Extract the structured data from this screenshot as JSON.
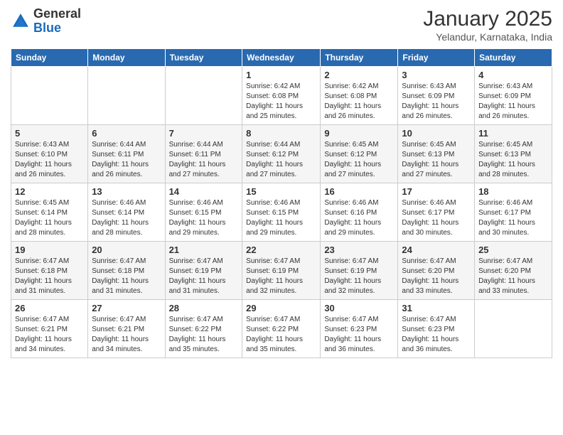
{
  "logo": {
    "general": "General",
    "blue": "Blue"
  },
  "title": "January 2025",
  "location": "Yelandur, Karnataka, India",
  "days_of_week": [
    "Sunday",
    "Monday",
    "Tuesday",
    "Wednesday",
    "Thursday",
    "Friday",
    "Saturday"
  ],
  "weeks": [
    [
      {
        "day": "",
        "info": ""
      },
      {
        "day": "",
        "info": ""
      },
      {
        "day": "",
        "info": ""
      },
      {
        "day": "1",
        "info": "Sunrise: 6:42 AM\nSunset: 6:08 PM\nDaylight: 11 hours\nand 25 minutes."
      },
      {
        "day": "2",
        "info": "Sunrise: 6:42 AM\nSunset: 6:08 PM\nDaylight: 11 hours\nand 26 minutes."
      },
      {
        "day": "3",
        "info": "Sunrise: 6:43 AM\nSunset: 6:09 PM\nDaylight: 11 hours\nand 26 minutes."
      },
      {
        "day": "4",
        "info": "Sunrise: 6:43 AM\nSunset: 6:09 PM\nDaylight: 11 hours\nand 26 minutes."
      }
    ],
    [
      {
        "day": "5",
        "info": "Sunrise: 6:43 AM\nSunset: 6:10 PM\nDaylight: 11 hours\nand 26 minutes."
      },
      {
        "day": "6",
        "info": "Sunrise: 6:44 AM\nSunset: 6:11 PM\nDaylight: 11 hours\nand 26 minutes."
      },
      {
        "day": "7",
        "info": "Sunrise: 6:44 AM\nSunset: 6:11 PM\nDaylight: 11 hours\nand 27 minutes."
      },
      {
        "day": "8",
        "info": "Sunrise: 6:44 AM\nSunset: 6:12 PM\nDaylight: 11 hours\nand 27 minutes."
      },
      {
        "day": "9",
        "info": "Sunrise: 6:45 AM\nSunset: 6:12 PM\nDaylight: 11 hours\nand 27 minutes."
      },
      {
        "day": "10",
        "info": "Sunrise: 6:45 AM\nSunset: 6:13 PM\nDaylight: 11 hours\nand 27 minutes."
      },
      {
        "day": "11",
        "info": "Sunrise: 6:45 AM\nSunset: 6:13 PM\nDaylight: 11 hours\nand 28 minutes."
      }
    ],
    [
      {
        "day": "12",
        "info": "Sunrise: 6:45 AM\nSunset: 6:14 PM\nDaylight: 11 hours\nand 28 minutes."
      },
      {
        "day": "13",
        "info": "Sunrise: 6:46 AM\nSunset: 6:14 PM\nDaylight: 11 hours\nand 28 minutes."
      },
      {
        "day": "14",
        "info": "Sunrise: 6:46 AM\nSunset: 6:15 PM\nDaylight: 11 hours\nand 29 minutes."
      },
      {
        "day": "15",
        "info": "Sunrise: 6:46 AM\nSunset: 6:15 PM\nDaylight: 11 hours\nand 29 minutes."
      },
      {
        "day": "16",
        "info": "Sunrise: 6:46 AM\nSunset: 6:16 PM\nDaylight: 11 hours\nand 29 minutes."
      },
      {
        "day": "17",
        "info": "Sunrise: 6:46 AM\nSunset: 6:17 PM\nDaylight: 11 hours\nand 30 minutes."
      },
      {
        "day": "18",
        "info": "Sunrise: 6:46 AM\nSunset: 6:17 PM\nDaylight: 11 hours\nand 30 minutes."
      }
    ],
    [
      {
        "day": "19",
        "info": "Sunrise: 6:47 AM\nSunset: 6:18 PM\nDaylight: 11 hours\nand 31 minutes."
      },
      {
        "day": "20",
        "info": "Sunrise: 6:47 AM\nSunset: 6:18 PM\nDaylight: 11 hours\nand 31 minutes."
      },
      {
        "day": "21",
        "info": "Sunrise: 6:47 AM\nSunset: 6:19 PM\nDaylight: 11 hours\nand 31 minutes."
      },
      {
        "day": "22",
        "info": "Sunrise: 6:47 AM\nSunset: 6:19 PM\nDaylight: 11 hours\nand 32 minutes."
      },
      {
        "day": "23",
        "info": "Sunrise: 6:47 AM\nSunset: 6:19 PM\nDaylight: 11 hours\nand 32 minutes."
      },
      {
        "day": "24",
        "info": "Sunrise: 6:47 AM\nSunset: 6:20 PM\nDaylight: 11 hours\nand 33 minutes."
      },
      {
        "day": "25",
        "info": "Sunrise: 6:47 AM\nSunset: 6:20 PM\nDaylight: 11 hours\nand 33 minutes."
      }
    ],
    [
      {
        "day": "26",
        "info": "Sunrise: 6:47 AM\nSunset: 6:21 PM\nDaylight: 11 hours\nand 34 minutes."
      },
      {
        "day": "27",
        "info": "Sunrise: 6:47 AM\nSunset: 6:21 PM\nDaylight: 11 hours\nand 34 minutes."
      },
      {
        "day": "28",
        "info": "Sunrise: 6:47 AM\nSunset: 6:22 PM\nDaylight: 11 hours\nand 35 minutes."
      },
      {
        "day": "29",
        "info": "Sunrise: 6:47 AM\nSunset: 6:22 PM\nDaylight: 11 hours\nand 35 minutes."
      },
      {
        "day": "30",
        "info": "Sunrise: 6:47 AM\nSunset: 6:23 PM\nDaylight: 11 hours\nand 36 minutes."
      },
      {
        "day": "31",
        "info": "Sunrise: 6:47 AM\nSunset: 6:23 PM\nDaylight: 11 hours\nand 36 minutes."
      },
      {
        "day": "",
        "info": ""
      }
    ]
  ]
}
